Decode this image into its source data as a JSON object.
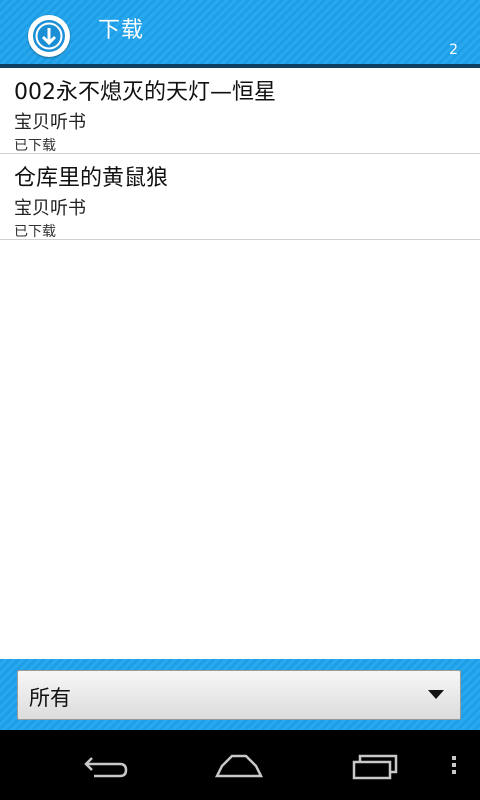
{
  "header": {
    "title": "下载",
    "count": "2",
    "icon": "download-icon"
  },
  "items": [
    {
      "title": "002永不熄灭的天灯—恒星",
      "subtitle": "宝贝听书",
      "status": "已下载"
    },
    {
      "title": "仓库里的黄鼠狼",
      "subtitle": "宝贝听书",
      "status": "已下载"
    }
  ],
  "filter": {
    "selected": "所有"
  },
  "nav": {
    "icons": [
      "back-icon",
      "home-icon",
      "recent-apps-icon",
      "menu-icon"
    ]
  },
  "colors": {
    "accent": "#1d9ee6",
    "navbar": "#000000"
  }
}
